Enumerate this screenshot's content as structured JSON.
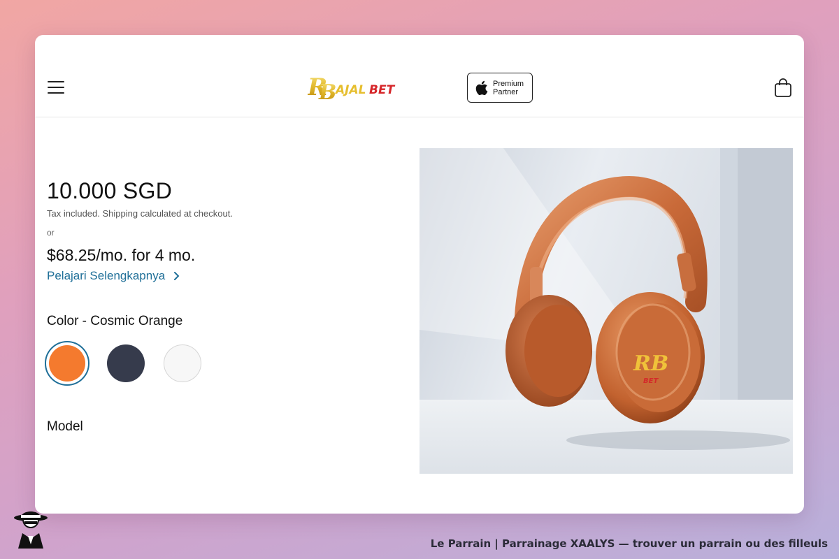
{
  "header": {
    "menu_icon": "hamburger-menu-icon",
    "logo_text": "RAJALBET",
    "badge": {
      "line1": "Premium",
      "line2": "Partner",
      "icon": "apple-logo-icon"
    },
    "cart_icon": "shopping-bag-icon"
  },
  "product": {
    "price": "10.000 SGD",
    "tax_note": "Tax included. Shipping calculated at checkout.",
    "or_text": "or",
    "installment": "$68.25/mo. for 4 mo.",
    "learn_more": "Pelajari Selengkapnya",
    "color_label": "Color - Cosmic Orange",
    "swatches": [
      {
        "name": "Cosmic Orange",
        "color": "#f47a2e",
        "selected": true
      },
      {
        "name": "Midnight",
        "color": "#363b4c",
        "selected": false
      },
      {
        "name": "White",
        "color": "#f7f7f7",
        "selected": false
      }
    ],
    "model_label": "Model",
    "image_icon": "orange-headphones-image"
  },
  "footer": {
    "caption": "Le Parrain | Parrainage XAALYS — trouver un parrain ou des filleuls",
    "watermark_icon": "mafia-man-hat-icon"
  }
}
